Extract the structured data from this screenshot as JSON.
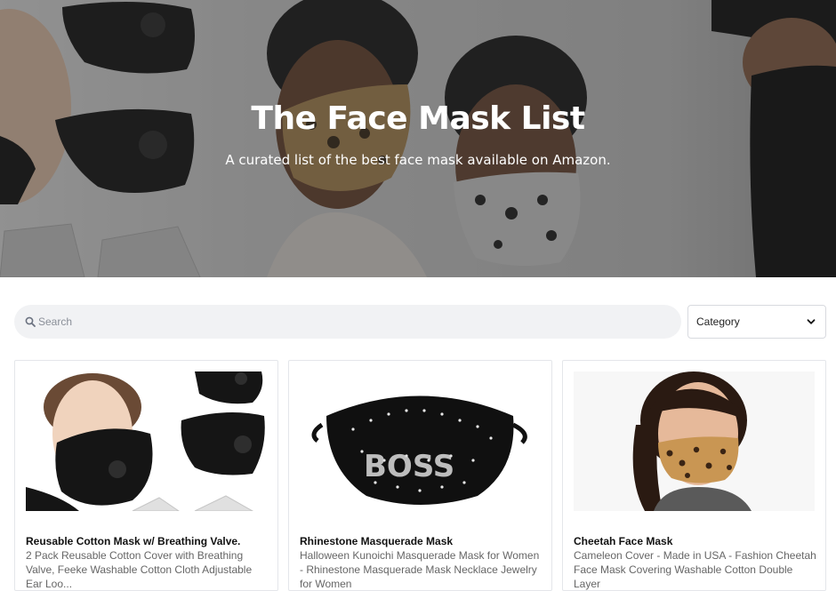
{
  "hero": {
    "title": "The Face Mask List",
    "subtitle": "A curated list of the best face mask available on Amazon."
  },
  "filters": {
    "search_placeholder": "Search",
    "category_label": "Category"
  },
  "products": [
    {
      "title": "Reusable Cotton Mask w/ Breathing Valve.",
      "description": "2 Pack Reusable Cotton Cover with Breathing Valve, Feeke Washable Cotton Cloth Adjustable Ear Loo..."
    },
    {
      "title": "Rhinestone Masquerade Mask",
      "description": "Halloween Kunoichi Masquerade Mask for Women - Rhinestone Masquerade Mask Necklace Jewelry for Women"
    },
    {
      "title": "Cheetah Face Mask",
      "description": "Cameleon Cover - Made in USA - Fashion Cheetah Face Mask Covering Washable Cotton Double Layer"
    }
  ],
  "colors": {
    "overlay": "#2a2a2a",
    "search_bg": "#f1f2f4",
    "text_primary": "#111111",
    "text_muted": "#666666"
  }
}
